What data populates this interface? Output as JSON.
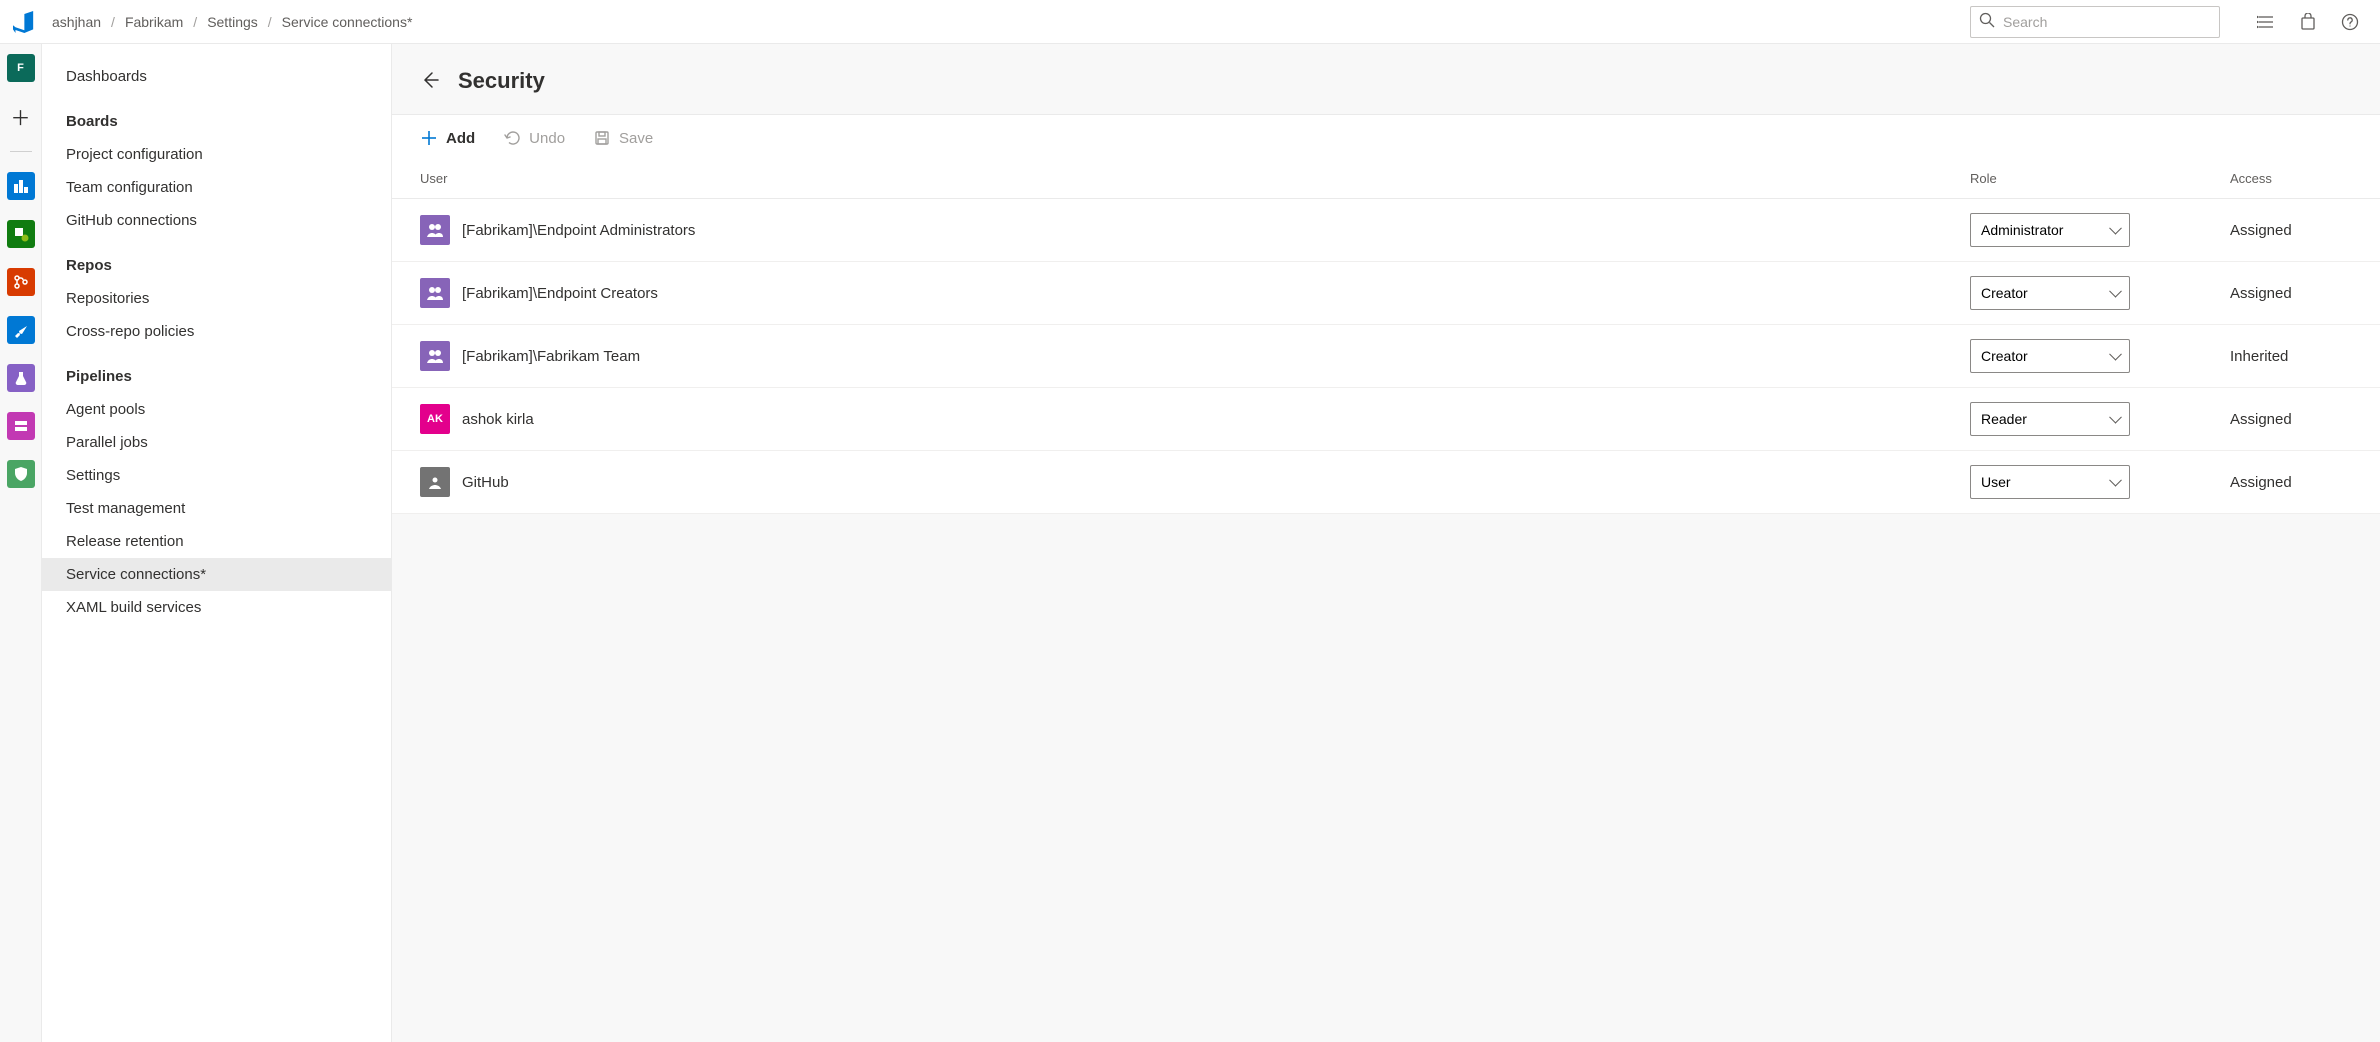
{
  "breadcrumbs": [
    "ashjhan",
    "Fabrikam",
    "Settings",
    "Service connections*"
  ],
  "search": {
    "placeholder": "Search"
  },
  "rail": {
    "project_initial": "F",
    "project_color": "#0b6a5a"
  },
  "sidebar": {
    "top_items": [
      "Dashboards"
    ],
    "sections": [
      {
        "header": "Boards",
        "items": [
          "Project configuration",
          "Team configuration",
          "GitHub connections"
        ]
      },
      {
        "header": "Repos",
        "items": [
          "Repositories",
          "Cross-repo policies"
        ]
      },
      {
        "header": "Pipelines",
        "items": [
          "Agent pools",
          "Parallel jobs",
          "Settings",
          "Test management",
          "Release retention",
          "Service connections*",
          "XAML build services"
        ]
      }
    ],
    "active": "Service connections*"
  },
  "page": {
    "title": "Security",
    "toolbar": {
      "add": "Add",
      "undo": "Undo",
      "save": "Save"
    },
    "columns": {
      "user": "User",
      "role": "Role",
      "access": "Access"
    },
    "rows": [
      {
        "name": "[Fabrikam]\\Endpoint Administrators",
        "avatar": "group",
        "role": "Administrator",
        "access": "Assigned"
      },
      {
        "name": "[Fabrikam]\\Endpoint Creators",
        "avatar": "group",
        "role": "Creator",
        "access": "Assigned"
      },
      {
        "name": "[Fabrikam]\\Fabrikam Team",
        "avatar": "group",
        "role": "Creator",
        "access": "Inherited"
      },
      {
        "name": "ashok kirla",
        "avatar": "ak",
        "initials": "AK",
        "role": "Reader",
        "access": "Assigned"
      },
      {
        "name": "GitHub",
        "avatar": "svc",
        "role": "User",
        "access": "Assigned"
      }
    ]
  }
}
